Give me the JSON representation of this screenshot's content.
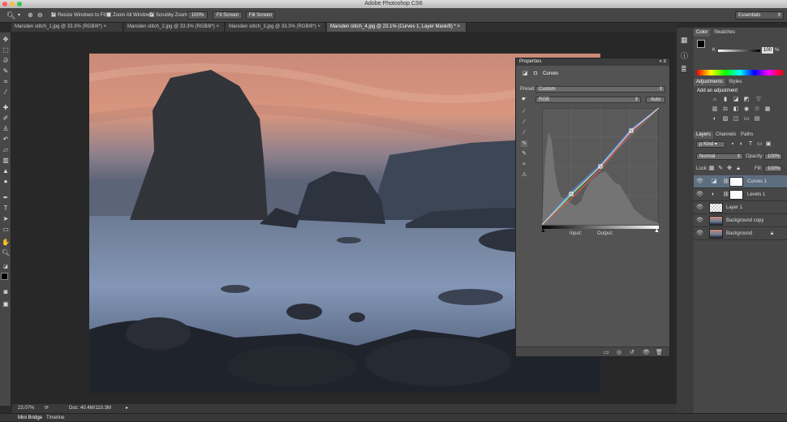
{
  "app": {
    "title": "Adobe Photoshop CS6"
  },
  "options": {
    "zoom_pct": "",
    "resize_windows": "Resize Windows to Fit",
    "zoom_all": "Zoom All Windows",
    "scrubby": "Scrubby Zoom",
    "btn_100": "100%",
    "btn_fit": "Fit Screen",
    "btn_fill": "Fill Screen",
    "workspace": "Essentials"
  },
  "tabs": [
    "Marsden stitch_1.jpg @ 33.3% (RGB/8*)",
    "Marsden stitch_2.jpg @ 33.3% (RGB/8*)",
    "Marsden stitch_3.jpg @ 33.3% (RGB/8*)",
    "Marsden stitch_4.jpg @ 23.1% (Curves 1, Layer Mask/8) *"
  ],
  "status": {
    "zoom": "23.07%",
    "doc": "Doc: 40.4M/110.3M"
  },
  "bottom_tabs": [
    "Mini Bridge",
    "Timeline"
  ],
  "properties": {
    "title": "Properties",
    "panel_name": "Curves",
    "preset_label": "Preset:",
    "preset_value": "Custom",
    "channel": "RGB",
    "auto": "Auto",
    "input_label": "Input:",
    "output_label": "Output:"
  },
  "color_panel": {
    "tab1": "Color",
    "tab2": "Swatches",
    "k_label": "K",
    "k_value": "100",
    "k_unit": "%"
  },
  "adjustments": {
    "tab1": "Adjustments",
    "tab2": "Styles",
    "heading": "Add an adjustment"
  },
  "layers_panel": {
    "tab1": "Layers",
    "tab2": "Channels",
    "tab3": "Paths",
    "kind": "Kind",
    "blend": "Normal",
    "opacity_label": "Opacity:",
    "opacity": "100%",
    "lock_label": "Lock:",
    "fill_label": "Fill:",
    "fill": "100%",
    "layers": [
      {
        "name": "Curves 1"
      },
      {
        "name": "Levels 1"
      },
      {
        "name": "Layer 1"
      },
      {
        "name": "Background copy"
      },
      {
        "name": "Background"
      }
    ]
  },
  "colors": {
    "selected_layer": "#5d6e80",
    "curve_composite": "#dddddd"
  }
}
